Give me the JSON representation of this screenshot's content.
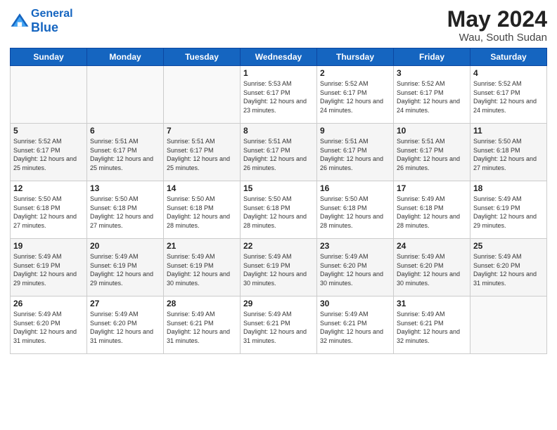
{
  "header": {
    "logo_line1": "General",
    "logo_line2": "Blue",
    "month": "May 2024",
    "location": "Wau, South Sudan"
  },
  "weekdays": [
    "Sunday",
    "Monday",
    "Tuesday",
    "Wednesday",
    "Thursday",
    "Friday",
    "Saturday"
  ],
  "weeks": [
    [
      {
        "day": "",
        "sunrise": "",
        "sunset": "",
        "daylight": ""
      },
      {
        "day": "",
        "sunrise": "",
        "sunset": "",
        "daylight": ""
      },
      {
        "day": "",
        "sunrise": "",
        "sunset": "",
        "daylight": ""
      },
      {
        "day": "1",
        "sunrise": "Sunrise: 5:53 AM",
        "sunset": "Sunset: 6:17 PM",
        "daylight": "Daylight: 12 hours and 23 minutes."
      },
      {
        "day": "2",
        "sunrise": "Sunrise: 5:52 AM",
        "sunset": "Sunset: 6:17 PM",
        "daylight": "Daylight: 12 hours and 24 minutes."
      },
      {
        "day": "3",
        "sunrise": "Sunrise: 5:52 AM",
        "sunset": "Sunset: 6:17 PM",
        "daylight": "Daylight: 12 hours and 24 minutes."
      },
      {
        "day": "4",
        "sunrise": "Sunrise: 5:52 AM",
        "sunset": "Sunset: 6:17 PM",
        "daylight": "Daylight: 12 hours and 24 minutes."
      }
    ],
    [
      {
        "day": "5",
        "sunrise": "Sunrise: 5:52 AM",
        "sunset": "Sunset: 6:17 PM",
        "daylight": "Daylight: 12 hours and 25 minutes."
      },
      {
        "day": "6",
        "sunrise": "Sunrise: 5:51 AM",
        "sunset": "Sunset: 6:17 PM",
        "daylight": "Daylight: 12 hours and 25 minutes."
      },
      {
        "day": "7",
        "sunrise": "Sunrise: 5:51 AM",
        "sunset": "Sunset: 6:17 PM",
        "daylight": "Daylight: 12 hours and 25 minutes."
      },
      {
        "day": "8",
        "sunrise": "Sunrise: 5:51 AM",
        "sunset": "Sunset: 6:17 PM",
        "daylight": "Daylight: 12 hours and 26 minutes."
      },
      {
        "day": "9",
        "sunrise": "Sunrise: 5:51 AM",
        "sunset": "Sunset: 6:17 PM",
        "daylight": "Daylight: 12 hours and 26 minutes."
      },
      {
        "day": "10",
        "sunrise": "Sunrise: 5:51 AM",
        "sunset": "Sunset: 6:17 PM",
        "daylight": "Daylight: 12 hours and 26 minutes."
      },
      {
        "day": "11",
        "sunrise": "Sunrise: 5:50 AM",
        "sunset": "Sunset: 6:18 PM",
        "daylight": "Daylight: 12 hours and 27 minutes."
      }
    ],
    [
      {
        "day": "12",
        "sunrise": "Sunrise: 5:50 AM",
        "sunset": "Sunset: 6:18 PM",
        "daylight": "Daylight: 12 hours and 27 minutes."
      },
      {
        "day": "13",
        "sunrise": "Sunrise: 5:50 AM",
        "sunset": "Sunset: 6:18 PM",
        "daylight": "Daylight: 12 hours and 27 minutes."
      },
      {
        "day": "14",
        "sunrise": "Sunrise: 5:50 AM",
        "sunset": "Sunset: 6:18 PM",
        "daylight": "Daylight: 12 hours and 28 minutes."
      },
      {
        "day": "15",
        "sunrise": "Sunrise: 5:50 AM",
        "sunset": "Sunset: 6:18 PM",
        "daylight": "Daylight: 12 hours and 28 minutes."
      },
      {
        "day": "16",
        "sunrise": "Sunrise: 5:50 AM",
        "sunset": "Sunset: 6:18 PM",
        "daylight": "Daylight: 12 hours and 28 minutes."
      },
      {
        "day": "17",
        "sunrise": "Sunrise: 5:49 AM",
        "sunset": "Sunset: 6:18 PM",
        "daylight": "Daylight: 12 hours and 28 minutes."
      },
      {
        "day": "18",
        "sunrise": "Sunrise: 5:49 AM",
        "sunset": "Sunset: 6:19 PM",
        "daylight": "Daylight: 12 hours and 29 minutes."
      }
    ],
    [
      {
        "day": "19",
        "sunrise": "Sunrise: 5:49 AM",
        "sunset": "Sunset: 6:19 PM",
        "daylight": "Daylight: 12 hours and 29 minutes."
      },
      {
        "day": "20",
        "sunrise": "Sunrise: 5:49 AM",
        "sunset": "Sunset: 6:19 PM",
        "daylight": "Daylight: 12 hours and 29 minutes."
      },
      {
        "day": "21",
        "sunrise": "Sunrise: 5:49 AM",
        "sunset": "Sunset: 6:19 PM",
        "daylight": "Daylight: 12 hours and 30 minutes."
      },
      {
        "day": "22",
        "sunrise": "Sunrise: 5:49 AM",
        "sunset": "Sunset: 6:19 PM",
        "daylight": "Daylight: 12 hours and 30 minutes."
      },
      {
        "day": "23",
        "sunrise": "Sunrise: 5:49 AM",
        "sunset": "Sunset: 6:20 PM",
        "daylight": "Daylight: 12 hours and 30 minutes."
      },
      {
        "day": "24",
        "sunrise": "Sunrise: 5:49 AM",
        "sunset": "Sunset: 6:20 PM",
        "daylight": "Daylight: 12 hours and 30 minutes."
      },
      {
        "day": "25",
        "sunrise": "Sunrise: 5:49 AM",
        "sunset": "Sunset: 6:20 PM",
        "daylight": "Daylight: 12 hours and 31 minutes."
      }
    ],
    [
      {
        "day": "26",
        "sunrise": "Sunrise: 5:49 AM",
        "sunset": "Sunset: 6:20 PM",
        "daylight": "Daylight: 12 hours and 31 minutes."
      },
      {
        "day": "27",
        "sunrise": "Sunrise: 5:49 AM",
        "sunset": "Sunset: 6:20 PM",
        "daylight": "Daylight: 12 hours and 31 minutes."
      },
      {
        "day": "28",
        "sunrise": "Sunrise: 5:49 AM",
        "sunset": "Sunset: 6:21 PM",
        "daylight": "Daylight: 12 hours and 31 minutes."
      },
      {
        "day": "29",
        "sunrise": "Sunrise: 5:49 AM",
        "sunset": "Sunset: 6:21 PM",
        "daylight": "Daylight: 12 hours and 31 minutes."
      },
      {
        "day": "30",
        "sunrise": "Sunrise: 5:49 AM",
        "sunset": "Sunset: 6:21 PM",
        "daylight": "Daylight: 12 hours and 32 minutes."
      },
      {
        "day": "31",
        "sunrise": "Sunrise: 5:49 AM",
        "sunset": "Sunset: 6:21 PM",
        "daylight": "Daylight: 12 hours and 32 minutes."
      },
      {
        "day": "",
        "sunrise": "",
        "sunset": "",
        "daylight": ""
      }
    ]
  ]
}
